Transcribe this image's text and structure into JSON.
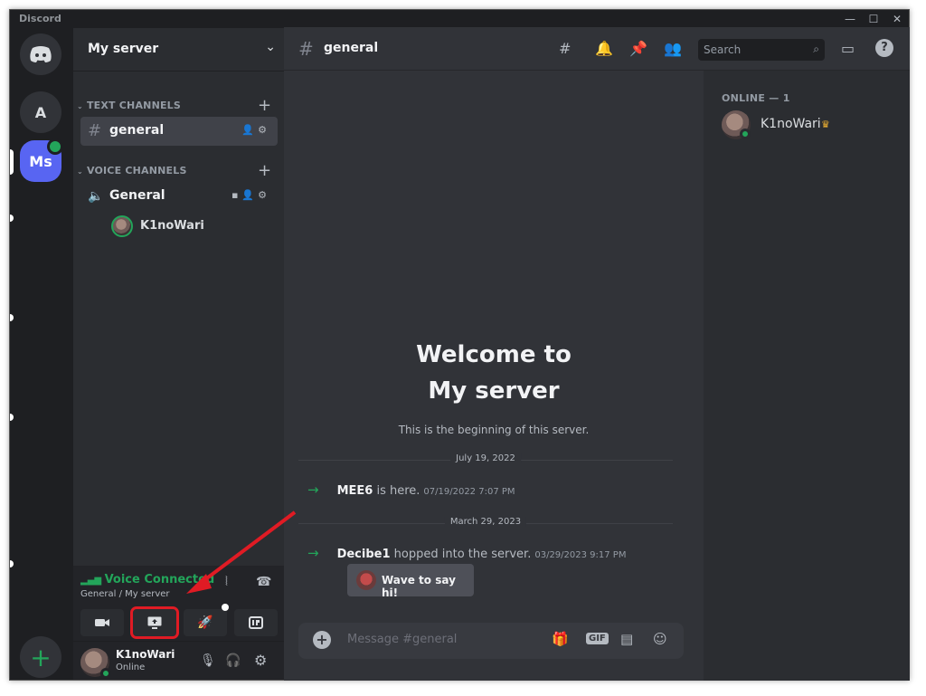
{
  "window": {
    "app_title": "Discord"
  },
  "servers": {
    "a_label": "A",
    "ms_label": "Ms"
  },
  "sidebar": {
    "server_name": "My server",
    "text_category": "TEXT CHANNELS",
    "voice_category": "VOICE CHANNELS",
    "text_channel": "general",
    "voice_channel": "General",
    "voice_user": "K1noWari"
  },
  "voice_panel": {
    "status": "Voice Connected",
    "location": "General / My server"
  },
  "user_panel": {
    "username": "K1noWari",
    "status": "Online"
  },
  "topbar": {
    "channel": "general",
    "search_placeholder": "Search"
  },
  "welcome": {
    "line1": "Welcome to",
    "line2": "My server",
    "subtitle": "This is the beginning of this server."
  },
  "messages": [
    {
      "date": "July 19, 2022",
      "user": "MEE6",
      "text": " is here.",
      "timestamp": "07/19/2022 7:07 PM"
    },
    {
      "date": "March 29, 2023",
      "user": "Decibe1",
      "text": " hopped into the server.",
      "timestamp": "03/29/2023 9:17 PM"
    }
  ],
  "wave_button": "Wave to say hi!",
  "composer": {
    "placeholder": "Message #general",
    "gif_label": "GIF"
  },
  "members": {
    "header": "ONLINE — 1",
    "list": [
      {
        "name": "K1noWari",
        "owner": true
      }
    ]
  },
  "colors": {
    "accent": "#5865f2",
    "online": "#23a55a",
    "annotation": "#e01b24"
  }
}
